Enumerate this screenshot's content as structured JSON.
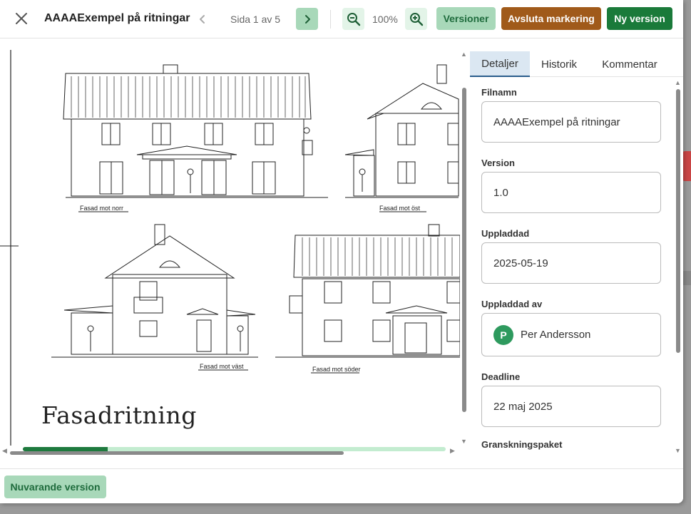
{
  "toolbar": {
    "title": "AAAAExempel på ritningar",
    "page_indicator": "Sida 1 av 5",
    "zoom": "100%",
    "versions_label": "Versioner",
    "end_marking_label": "Avsluta markering",
    "new_version_label": "Ny version",
    "icons": [
      "close-icon",
      "chevron-left-icon",
      "chevron-right-icon",
      "zoom-out-icon",
      "zoom-in-icon"
    ]
  },
  "document": {
    "drawing_labels": [
      "Fasad mot norr",
      "Fasad mot öst",
      "Fasad mot väst",
      "Fasad mot söder"
    ],
    "title": "Fasadritning",
    "progress_fraction": 0.2
  },
  "panel": {
    "tabs": [
      "Detaljer",
      "Historik",
      "Kommentar"
    ],
    "active_tab": "Detaljer",
    "fields": {
      "filename_label": "Filnamn",
      "filename_value": "AAAAExempel på ritningar",
      "version_label": "Version",
      "version_value": "1.0",
      "uploaded_label": "Uppladdad",
      "uploaded_value": "2025-05-19",
      "uploaded_by_label": "Uppladdad av",
      "uploaded_by_initial": "P",
      "uploaded_by_value": "Per Andersson",
      "deadline_label": "Deadline",
      "deadline_value": "22 maj 2025",
      "review_package_label": "Granskningspaket"
    }
  },
  "footer": {
    "current_version_label": "Nuvarande version"
  },
  "colors": {
    "primary_green": "#1a7a3a",
    "light_green": "#a8d8b9",
    "brown": "#a05a1a",
    "tab_active_bg": "#dbe7f2"
  }
}
